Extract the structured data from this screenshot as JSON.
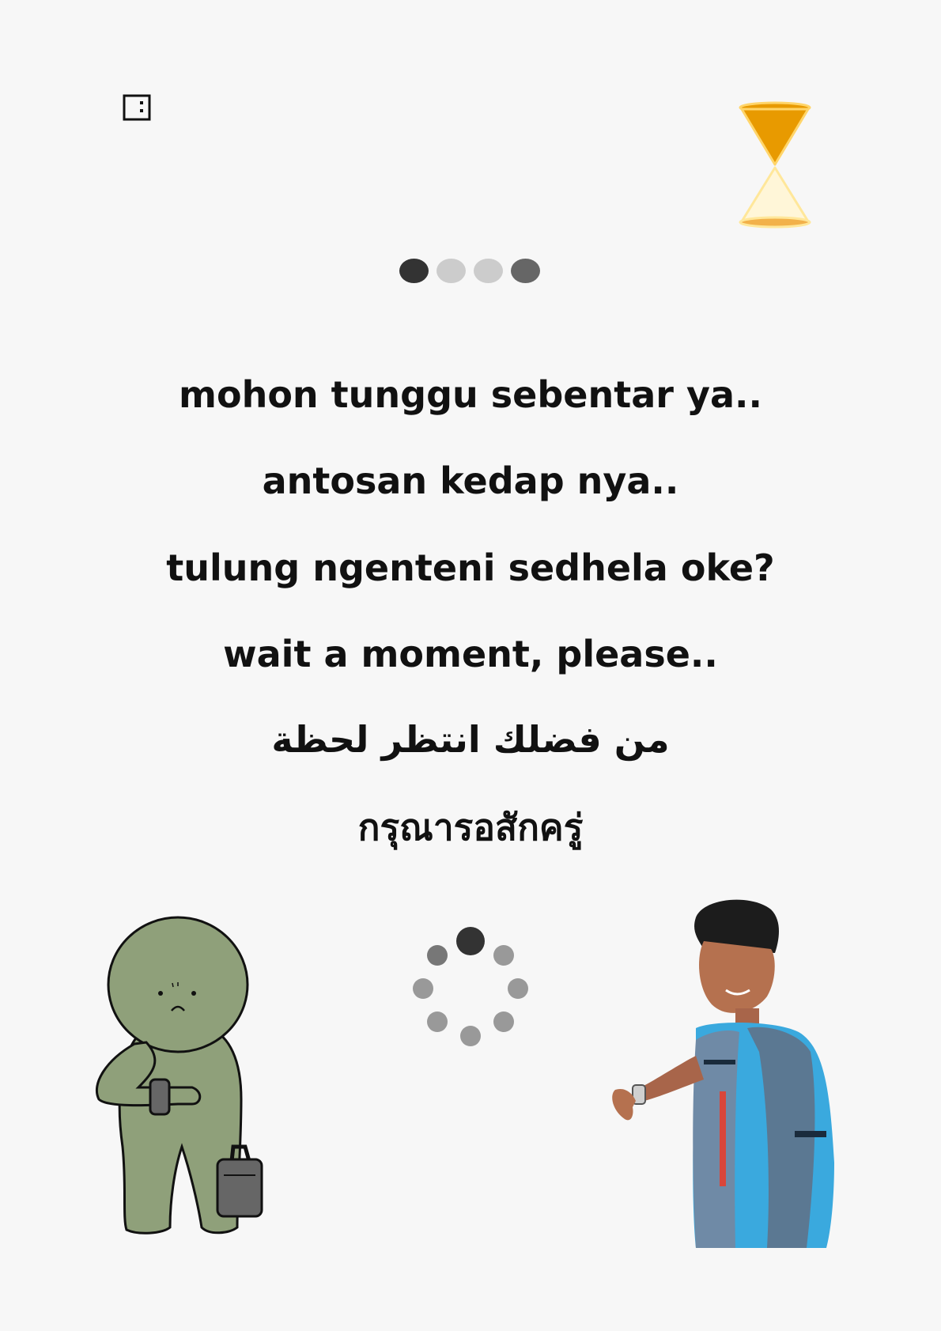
{
  "messages": {
    "indonesian": "mohon tunggu sebentar ya..",
    "sundanese": "antosan kedap nya..",
    "javanese": "tulung ngenteni sedhela oke?",
    "english": "wait a moment, please..",
    "arabic": "من فضلك انتظر لحظة",
    "thai": "กรุณารอสักครู่"
  },
  "icons": {
    "corner": "window-layout-icon",
    "hourglass": "hourglass-icon",
    "top_loader": "loading-dots-icon",
    "spinner": "loading-spinner-icon",
    "character": "waiting-character-illustration",
    "person": "person-checking-watch-photo"
  },
  "colors": {
    "background": "#f7f7f7",
    "text": "#111111",
    "hourglass_sand": "#e89a00",
    "character_skin": "#8fa07a",
    "dot_dark": "#333333",
    "dot_light": "#cccccc",
    "dot_mid": "#666666"
  }
}
